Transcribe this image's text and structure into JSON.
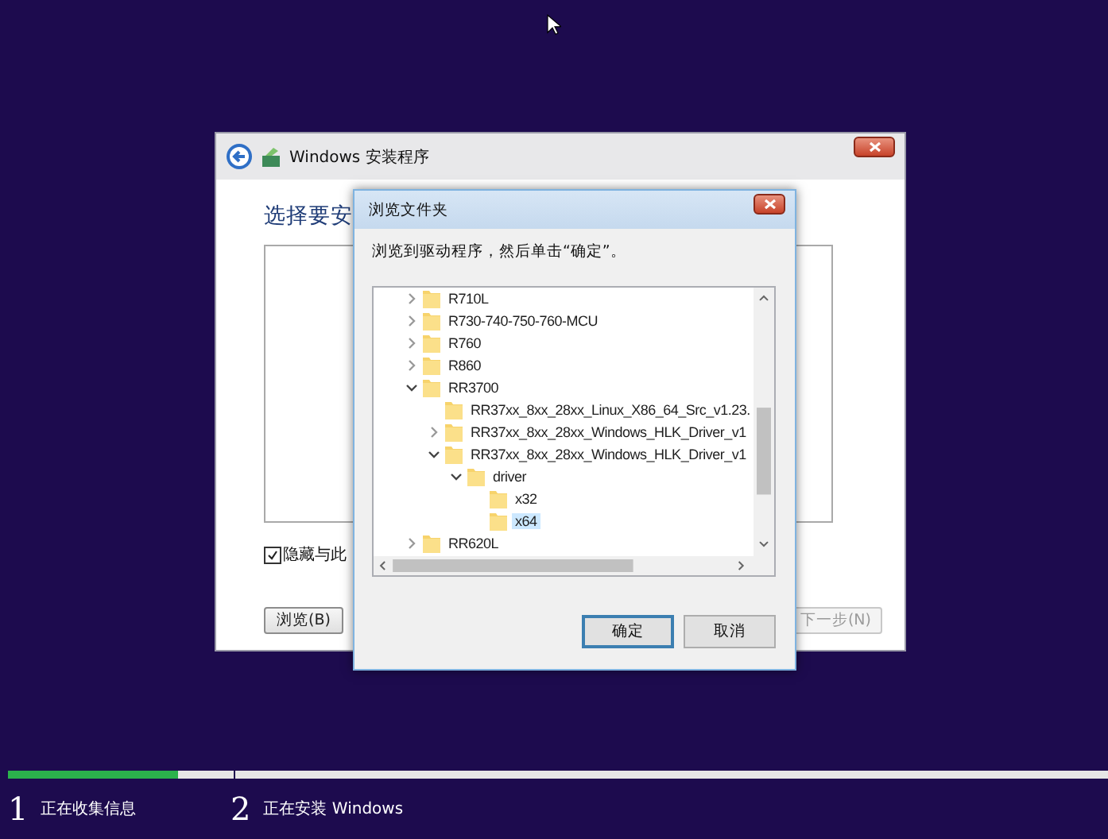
{
  "setup_window": {
    "title": "Windows 安装程序",
    "heading": "选择要安",
    "checkbox": {
      "label": "隐藏与此",
      "checked": true
    },
    "buttons": [
      {
        "label": "浏览(B)",
        "disabled": false
      },
      {
        "label": "下一步(N)",
        "disabled": true
      }
    ]
  },
  "dialog": {
    "title": "浏览文件夹",
    "instruction": "浏览到驱动程序，然后单击“确定”。",
    "tree": [
      {
        "label": "R710L",
        "expanded": false,
        "selected": false
      },
      {
        "label": "R730-740-750-760-MCU",
        "expanded": false,
        "selected": false
      },
      {
        "label": "R760",
        "expanded": false,
        "selected": false
      },
      {
        "label": "R860",
        "expanded": false,
        "selected": false
      },
      {
        "label": "RR3700",
        "expanded": true,
        "selected": false,
        "children": [
          {
            "label": "RR37xx_8xx_28xx_Linux_X86_64_Src_v1.23.",
            "selected": false
          },
          {
            "label": "RR37xx_8xx_28xx_Windows_HLK_Driver_v1",
            "expanded": false,
            "selected": false
          },
          {
            "label": "RR37xx_8xx_28xx_Windows_HLK_Driver_v1",
            "expanded": true,
            "selected": false,
            "children": [
              {
                "label": "driver",
                "expanded": true,
                "selected": false,
                "children": [
                  {
                    "label": "x32",
                    "selected": false
                  },
                  {
                    "label": "x64",
                    "selected": true
                  }
                ]
              }
            ]
          }
        ]
      },
      {
        "label": "RR620L",
        "expanded": false,
        "selected": false
      }
    ],
    "buttons": [
      {
        "label": "确定",
        "default": true
      },
      {
        "label": "取消",
        "default": false
      }
    ]
  },
  "progress": {
    "level": 0.75
  },
  "steps": [
    {
      "number": "1",
      "label": "正在收集信息"
    },
    {
      "number": "2",
      "label": "正在安装 Windows"
    }
  ]
}
